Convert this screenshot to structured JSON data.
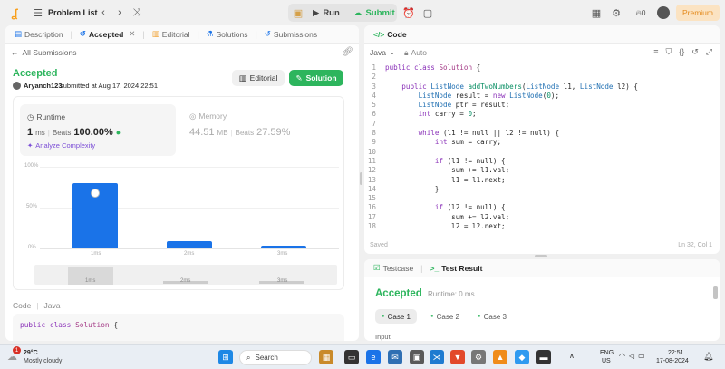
{
  "topbar": {
    "problem_list": "Problem List",
    "run": "Run",
    "submit": "Submit",
    "streak": "0",
    "premium": "Premium"
  },
  "left_tabs": [
    {
      "label": "Description"
    },
    {
      "label": "Accepted"
    },
    {
      "label": "Editorial"
    },
    {
      "label": "Solutions"
    },
    {
      "label": "Submissions"
    }
  ],
  "submission": {
    "back": "All Submissions",
    "status": "Accepted",
    "user": "Aryanch123",
    "submitted": "submitted at Aug 17, 2024 22:51",
    "editorial_btn": "Editorial",
    "solution_btn": "Solution"
  },
  "runtime": {
    "label": "Runtime",
    "value": "1",
    "unit": "ms",
    "beats_label": "Beats",
    "beats": "100.00%",
    "analyze": "Analyze Complexity"
  },
  "memory": {
    "label": "Memory",
    "value": "44.51",
    "unit": "MB",
    "beats_label": "Beats",
    "beats": "27.59%"
  },
  "chart_data": {
    "type": "bar",
    "categories": [
      "1ms",
      "2ms",
      "3ms"
    ],
    "values": [
      80,
      9,
      3
    ],
    "y_ticks": [
      "100%",
      "50%",
      "0%"
    ],
    "ylim": [
      0,
      100
    ],
    "mini_categories": [
      "1ms",
      "2ms",
      "3ms"
    ]
  },
  "left_code": {
    "label": "Code",
    "lang": "Java",
    "line": "public class Solution {"
  },
  "editor": {
    "title": "Code",
    "lang": "Java",
    "auto": "Auto",
    "saved": "Saved",
    "position": "Ln 32, Col 1",
    "lines": [
      "public class Solution {",
      "",
      "    public ListNode addTwoNumbers(ListNode l1, ListNode l2) {",
      "        ListNode result = new ListNode(0);",
      "        ListNode ptr = result;",
      "        int carry = 0;",
      "",
      "        while (l1 != null || l2 != null) {",
      "            int sum = carry;",
      "",
      "            if (l1 != null) {",
      "                sum += l1.val;",
      "                l1 = l1.next;",
      "            }",
      "",
      "            if (l2 != null) {",
      "                sum += l2.val;",
      "                l2 = l2.next;"
    ]
  },
  "result_panel": {
    "testcase_tab": "Testcase",
    "result_tab": "Test Result",
    "status": "Accepted",
    "runtime": "Runtime: 0 ms",
    "cases": [
      "Case 1",
      "Case 2",
      "Case 3"
    ],
    "input_label": "Input"
  },
  "taskbar": {
    "temp": "29°C",
    "weather": "Mostly cloudy",
    "search": "Search",
    "lang1": "ENG",
    "lang2": "US",
    "time": "22:51",
    "date": "17-08-2024",
    "notif_count": "1"
  },
  "colors": {
    "accent_green": "#2db55d",
    "bar_blue": "#1a73e8",
    "premium_orange": "#e48a1c"
  }
}
